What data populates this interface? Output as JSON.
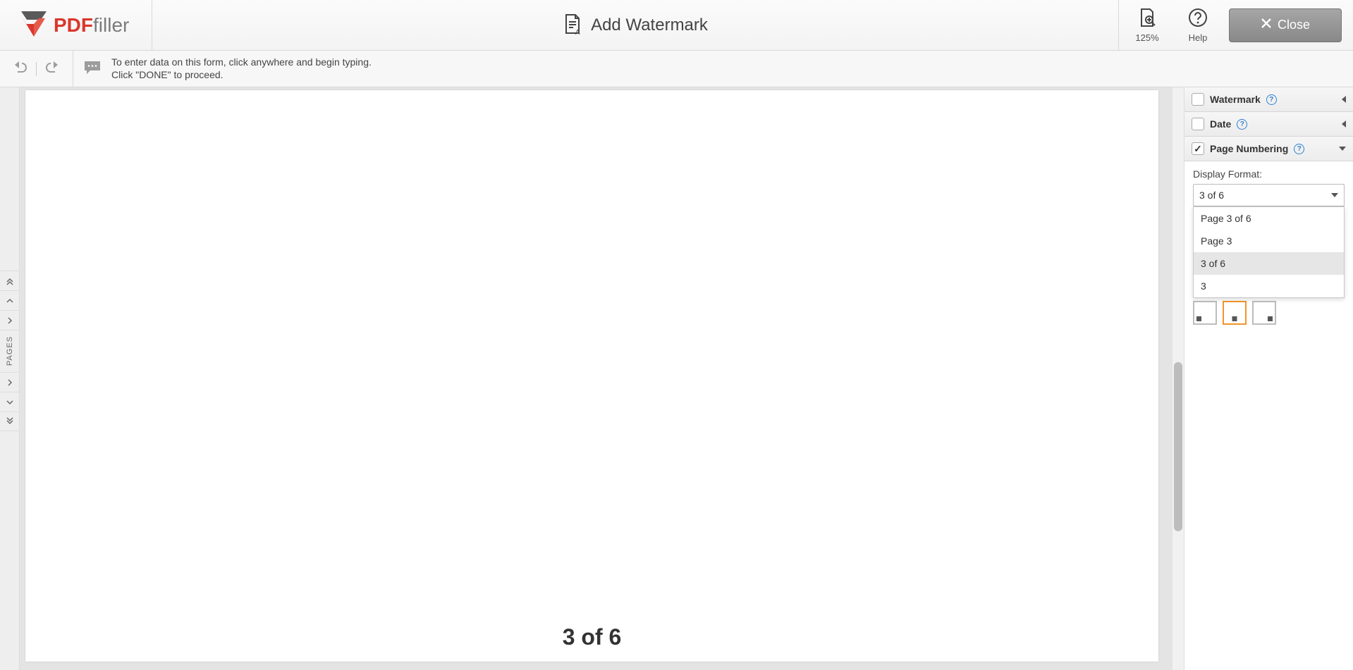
{
  "brand": {
    "pdf": "PDF",
    "filler": "filler"
  },
  "header": {
    "title": "Add Watermark",
    "zoom_label": "125%",
    "help_label": "Help",
    "close_label": "Close"
  },
  "hint": {
    "line1": "To enter data on this form, click anywhere and begin typing.",
    "line2": "Click \"DONE\" to proceed."
  },
  "leftrail": {
    "pages_label": "PAGES"
  },
  "document": {
    "page_number_display": "3 of 6"
  },
  "panel": {
    "watermark": {
      "label": "Watermark",
      "checked": false,
      "expanded": false
    },
    "date": {
      "label": "Date",
      "checked": false,
      "expanded": false
    },
    "page_numbering": {
      "label": "Page Numbering",
      "checked": true,
      "expanded": true,
      "display_format_label": "Display Format:",
      "selected": "3 of 6",
      "options": [
        "Page 3 of 6",
        "Page 3",
        "3 of 6",
        "3"
      ],
      "position": "bottom-center"
    }
  }
}
